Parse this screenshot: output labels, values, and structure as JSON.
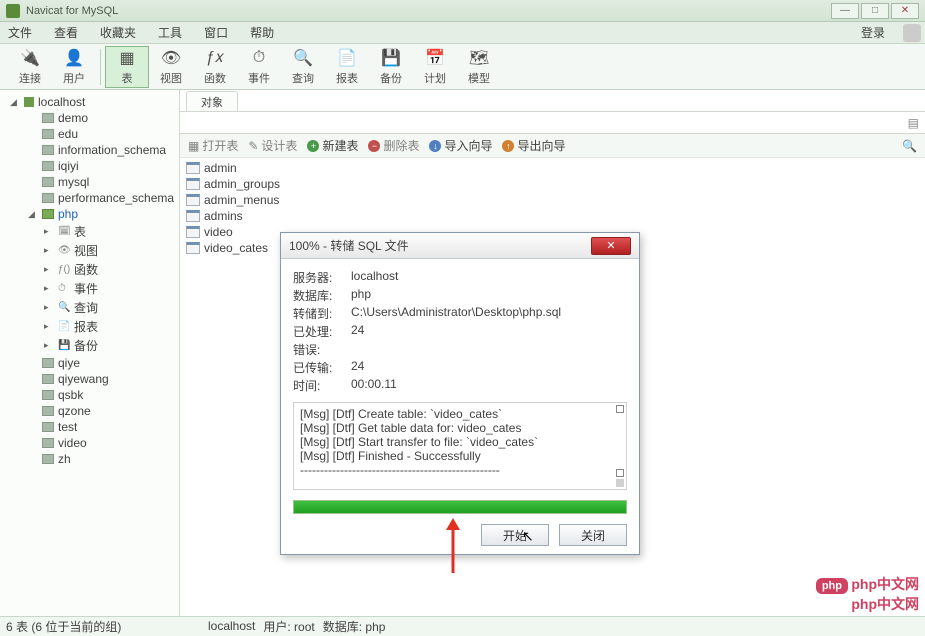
{
  "app": {
    "title": "Navicat for MySQL"
  },
  "menu": {
    "file": "文件",
    "view": "查看",
    "fav": "收藏夹",
    "tool": "工具",
    "window": "窗口",
    "help": "帮助",
    "login": "登录"
  },
  "toolbar": {
    "connect": "连接",
    "user": "用户",
    "table": "表",
    "view": "视图",
    "func": "函数",
    "event": "事件",
    "query": "查询",
    "report": "报表",
    "backup": "备份",
    "plan": "计划",
    "model": "模型"
  },
  "tree": {
    "conn": "localhost",
    "dbs": [
      "demo",
      "edu",
      "information_schema",
      "iqiyi",
      "mysql",
      "performance_schema"
    ],
    "active_db": "php",
    "php_children": [
      {
        "icon": "🗓",
        "label": "表"
      },
      {
        "icon": "👁",
        "label": "视图"
      },
      {
        "icon": "ƒ()",
        "label": "函数"
      },
      {
        "icon": "⏱",
        "label": "事件"
      },
      {
        "icon": "🔍",
        "label": "查询"
      },
      {
        "icon": "📄",
        "label": "报表"
      },
      {
        "icon": "💾",
        "label": "备份"
      }
    ],
    "rest_dbs": [
      "qiye",
      "qiyewang",
      "qsbk",
      "qzone",
      "test",
      "video",
      "zh"
    ]
  },
  "tabs": {
    "objects": "对象"
  },
  "actions": {
    "open": "打开表",
    "design": "设计表",
    "create": "新建表",
    "delete": "删除表",
    "import": "导入向导",
    "export": "导出向导"
  },
  "tables": [
    "admin",
    "admin_groups",
    "admin_menus",
    "admins",
    "video",
    "video_cates"
  ],
  "dialog": {
    "title": "100% - 转储 SQL 文件",
    "labels": {
      "server": "服务器:",
      "db": "数据库:",
      "dest": "转储到:",
      "processed": "已处理:",
      "errors": "错误:",
      "transferred": "已传输:",
      "time": "时间:"
    },
    "values": {
      "server": "localhost",
      "db": "php",
      "dest": "C:\\Users\\Administrator\\Desktop\\php.sql",
      "processed": "24",
      "errors": "",
      "transferred": "24",
      "time": "00:00.11"
    },
    "log": [
      "[Msg] [Dtf] Create table: `video_cates`",
      "[Msg] [Dtf] Get table data for: video_cates",
      "[Msg] [Dtf] Start transfer to file: `video_cates`",
      "[Msg] [Dtf] Finished - Successfully",
      "--------------------------------------------------"
    ],
    "start": "开始",
    "close": "关闭"
  },
  "status": {
    "left": "6 表 (6 位于当前的组)",
    "conn": "localhost",
    "user": "用户: root",
    "db": "数据库: php"
  },
  "watermark": {
    "php": "php",
    "cn": "php中文网\nphp中文网"
  }
}
